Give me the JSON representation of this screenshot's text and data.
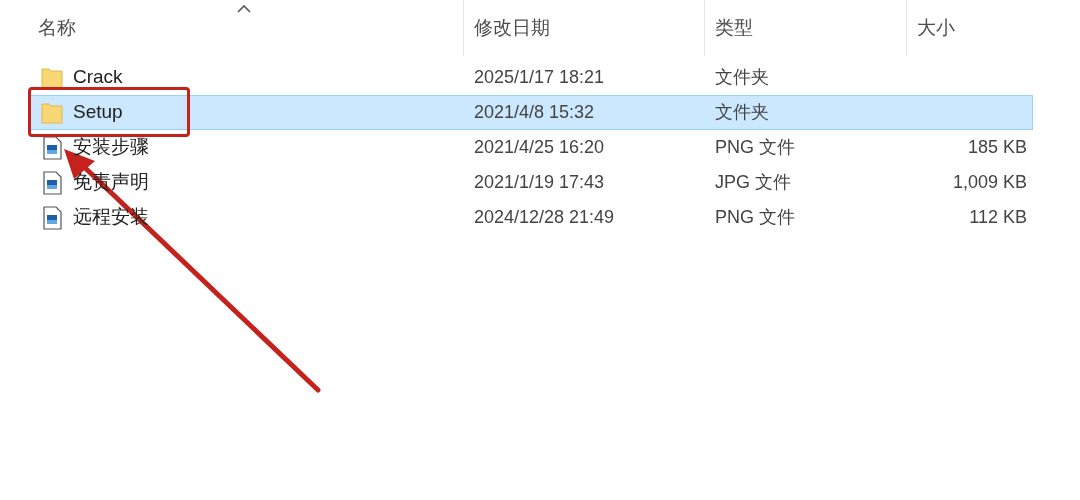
{
  "columns": [
    {
      "label": "名称",
      "sorted": true
    },
    {
      "label": "修改日期",
      "sorted": false
    },
    {
      "label": "类型",
      "sorted": false
    },
    {
      "label": "大小",
      "sorted": false
    }
  ],
  "files": [
    {
      "kind": "folder",
      "name": "Crack",
      "modified": "2025/1/17 18:21",
      "type": "文件夹",
      "selected": false,
      "highlighted": false
    },
    {
      "kind": "folder",
      "name": "Setup",
      "modified": "2021/4/8 15:32",
      "type": "文件夹",
      "selected": true,
      "highlighted": true
    },
    {
      "kind": "image",
      "name": "安装步骤",
      "modified": "2021/4/25 16:20",
      "type": "PNG 文件",
      "size": "185 KB",
      "selected": false,
      "highlighted": false
    },
    {
      "kind": "image",
      "name": "免责声明",
      "modified": "2021/1/19 17:43",
      "type": "JPG 文件",
      "size": "1,009 KB",
      "selected": false,
      "highlighted": false
    },
    {
      "kind": "image",
      "name": "远程安装",
      "modified": "2024/12/28 21:49",
      "type": "PNG 文件",
      "size": "112 KB",
      "selected": false,
      "highlighted": false
    }
  ]
}
